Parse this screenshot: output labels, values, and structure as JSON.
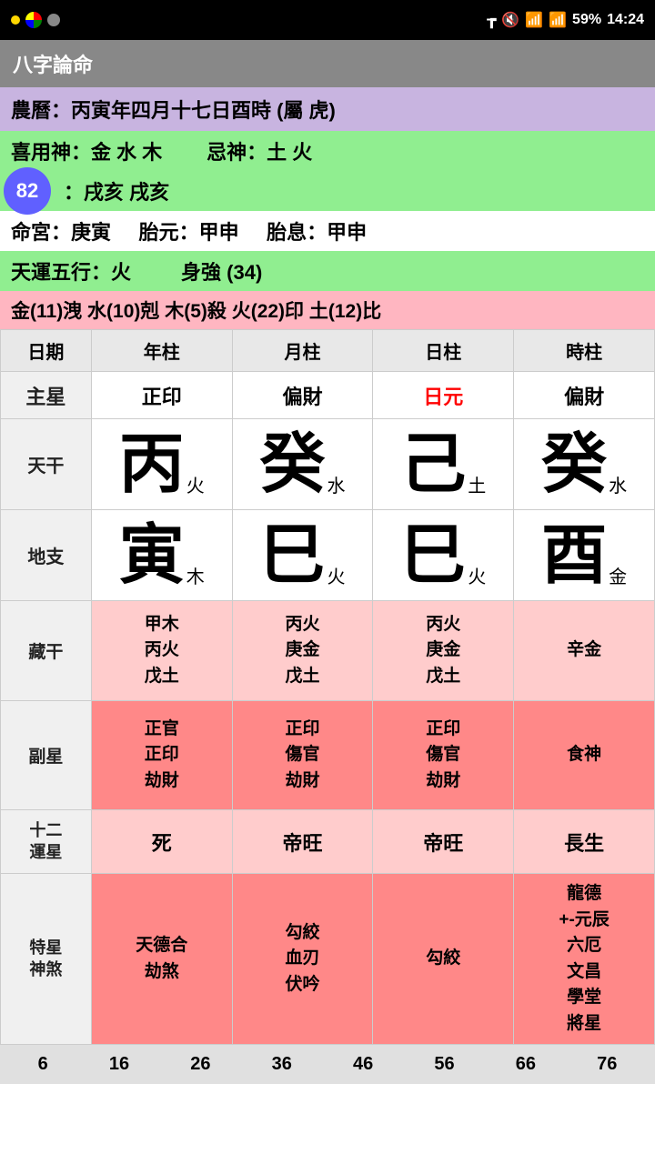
{
  "statusBar": {
    "time": "14:24",
    "battery": "59%",
    "icons": [
      "bluetooth",
      "mute",
      "wifi",
      "signal"
    ]
  },
  "titleBar": {
    "title": "八字論命"
  },
  "infoRows": {
    "lunarDate": "農曆：丙寅年四月十七日酉時 (屬 虎)",
    "favorableGods": "喜用神：金 水 木",
    "unfavorableGods": "忌神：土 火",
    "badge": "82",
    "specialStars": "：戌亥 戌亥",
    "lifePalace": "命宮：庚寅",
    "fetal1": "胎元：甲申",
    "fetal2": "胎息：甲申",
    "tianYun": "天運五行：火",
    "bodyStrength": "身強 (34)",
    "elements": "金(11)洩  水(10)剋  木(5)殺  火(22)印  土(12)比"
  },
  "tableHeaders": [
    "日期",
    "年柱",
    "月柱",
    "日柱",
    "時柱"
  ],
  "zhuxingRow": {
    "label": "主星",
    "year": "正印",
    "month": "偏財",
    "day": "日元",
    "hour": "偏財"
  },
  "tianGanRow": {
    "label": "天干",
    "year": {
      "char": "丙",
      "element": "火"
    },
    "month": {
      "char": "癸",
      "element": "水"
    },
    "day": {
      "char": "己",
      "element": "土"
    },
    "hour": {
      "char": "癸",
      "element": "水"
    }
  },
  "diZhiRow": {
    "label": "地支",
    "year": {
      "char": "寅",
      "element": "木"
    },
    "month": {
      "char": "巳",
      "element": "火"
    },
    "day": {
      "char": "巳",
      "element": "火"
    },
    "hour": {
      "char": "酉",
      "element": "金"
    }
  },
  "zangGanRow": {
    "label": "藏干",
    "year": [
      "甲木",
      "丙火",
      "戊土"
    ],
    "month": [
      "丙火",
      "庚金",
      "戊土"
    ],
    "day": [
      "丙火",
      "庚金",
      "戊土"
    ],
    "hour": [
      "辛金"
    ]
  },
  "fuXingRow": {
    "label": "副星",
    "year": [
      "正官",
      "正印",
      "劫財"
    ],
    "month": [
      "正印",
      "傷官",
      "劫財"
    ],
    "day": [
      "正印",
      "傷官",
      "劫財"
    ],
    "hour": [
      "食神"
    ]
  },
  "yunXingRow": {
    "label": "十二\n運星",
    "year": "死",
    "month": "帝旺",
    "day": "帝旺",
    "hour": "長生"
  },
  "teXingRow": {
    "label": "特星\n神煞",
    "year": [
      "天德合",
      "劫煞"
    ],
    "month": [
      "勾絞",
      "血刃",
      "伏吟"
    ],
    "day": [
      "勾絞"
    ],
    "hour": [
      "龍德",
      "+-元辰",
      "六厄",
      "文昌",
      "學堂",
      "將星"
    ]
  },
  "bottomNumbers": [
    "6",
    "16",
    "26",
    "36",
    "46",
    "56",
    "66",
    "76"
  ]
}
